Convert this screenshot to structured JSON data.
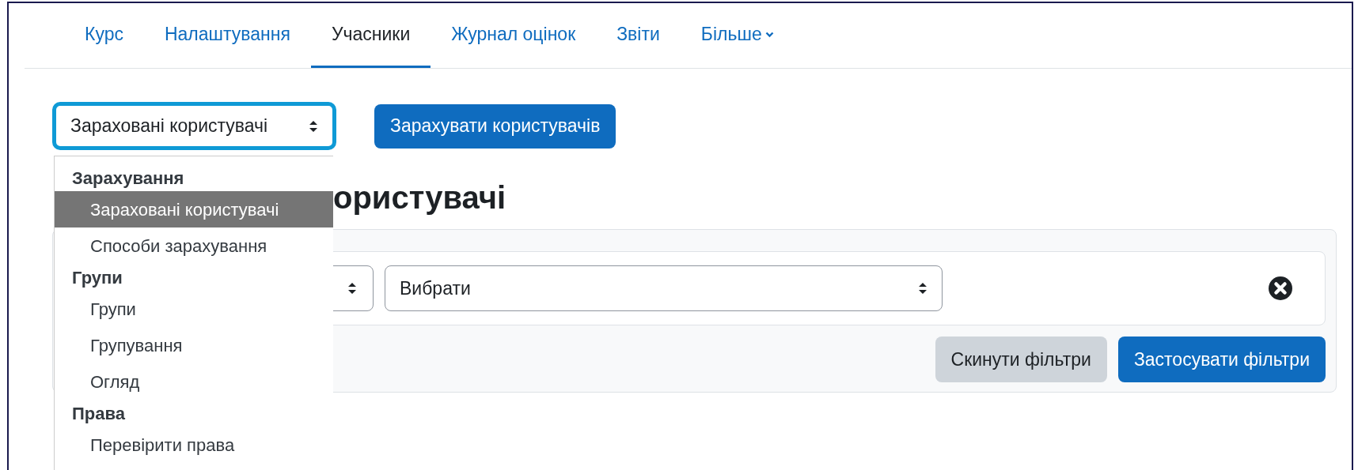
{
  "nav": {
    "tabs": [
      {
        "label": "Курс",
        "selected": false,
        "has_menu": false
      },
      {
        "label": "Налаштування",
        "selected": false,
        "has_menu": false
      },
      {
        "label": "Учасники",
        "selected": true,
        "has_menu": false
      },
      {
        "label": "Журнал оцінок",
        "selected": false,
        "has_menu": false
      },
      {
        "label": "Звіти",
        "selected": false,
        "has_menu": false
      },
      {
        "label": "Більше",
        "selected": false,
        "has_menu": true
      }
    ]
  },
  "page_select": {
    "value": "Зараховані користувачі",
    "focused": true,
    "expanded": true
  },
  "enrol_button": "Зарахувати користувачів",
  "dropdown": {
    "groups": [
      {
        "label": "Зарахування",
        "items": [
          {
            "label": "Зараховані користувачі",
            "selected": true
          },
          {
            "label": "Способи зарахування",
            "selected": false
          }
        ]
      },
      {
        "label": "Групи",
        "items": [
          {
            "label": "Групи",
            "selected": false
          },
          {
            "label": "Групування",
            "selected": false
          },
          {
            "label": "Огляд",
            "selected": false
          }
        ]
      },
      {
        "label": "Права",
        "items": [
          {
            "label": "Перевірити права",
            "selected": false
          }
        ]
      }
    ]
  },
  "heading": "ористувачі",
  "filters": {
    "value_select": "Вибрати",
    "reset_button": "Скинути фільтри",
    "apply_button": "Застосувати фільтри"
  }
}
